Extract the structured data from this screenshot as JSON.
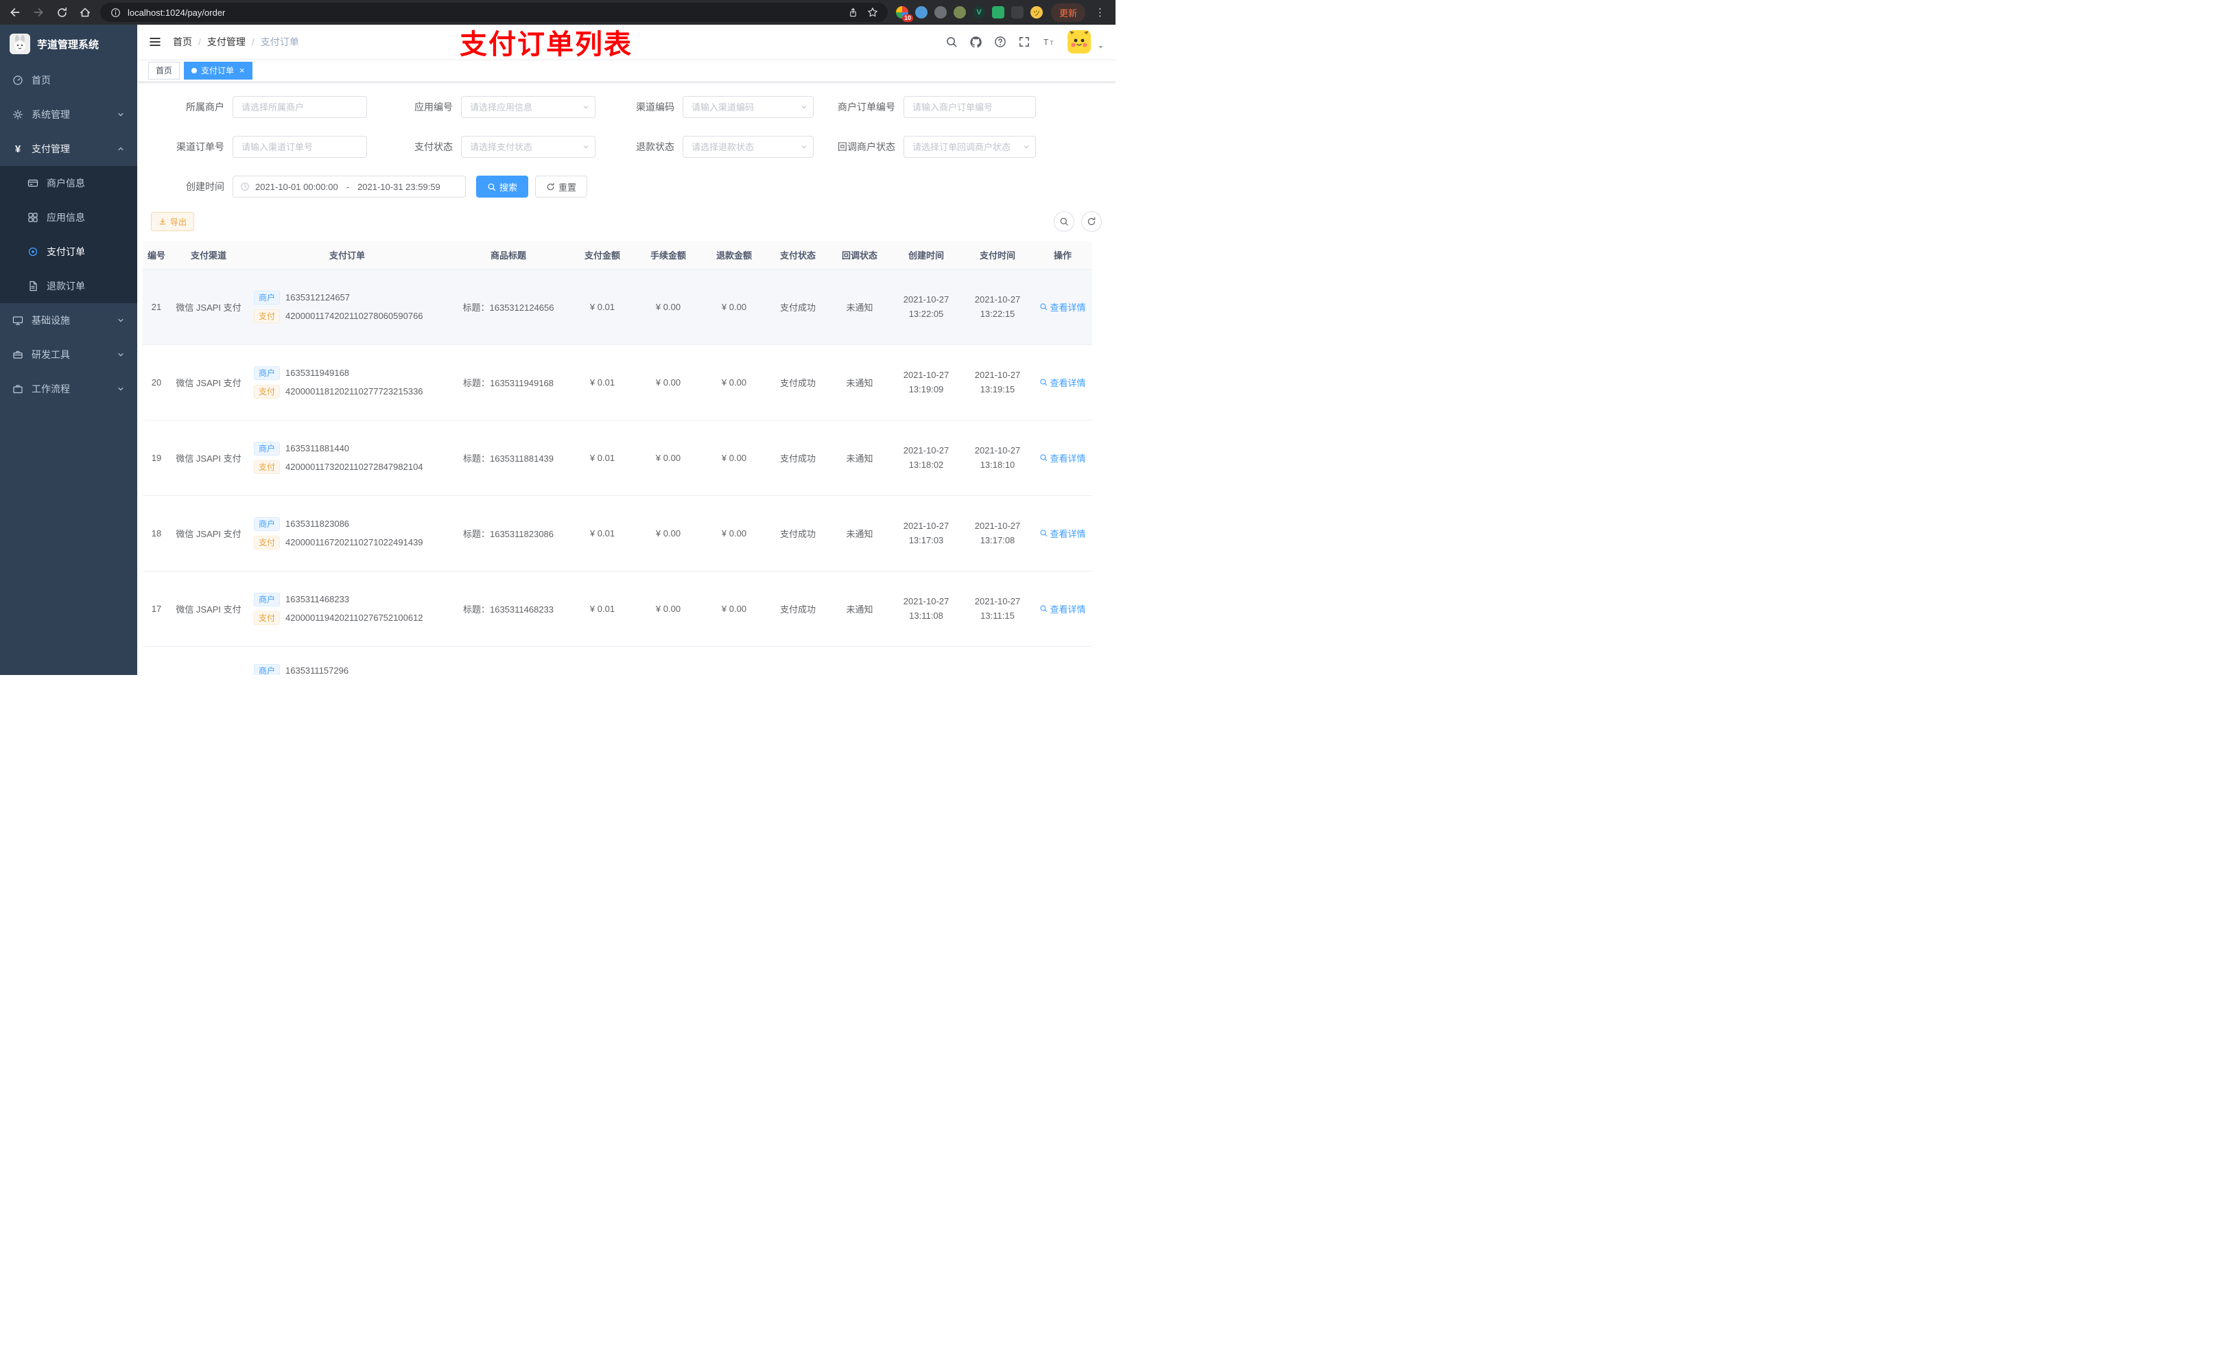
{
  "browser": {
    "url": "localhost:1024/pay/order",
    "update_label": "更新",
    "extension_badge": "10"
  },
  "sidebar": {
    "logo_title": "芋道管理系统",
    "menu": {
      "home": "首页",
      "system": "系统管理",
      "pay": "支付管理",
      "merchant_info": "商户信息",
      "app_info": "应用信息",
      "pay_order": "支付订单",
      "refund_order": "退款订单",
      "infra": "基础设施",
      "dev_tools": "研发工具",
      "workflow": "工作流程"
    }
  },
  "navbar": {
    "breadcrumb": [
      "首页",
      "支付管理",
      "支付订单"
    ],
    "annotation": "支付订单列表"
  },
  "tabs": {
    "home": "首页",
    "current": "支付订单"
  },
  "filters": {
    "merchant": {
      "label": "所属商户",
      "placeholder": "请选择所属商户"
    },
    "app": {
      "label": "应用编号",
      "placeholder": "请选择应用信息"
    },
    "channel_code": {
      "label": "渠道编码",
      "placeholder": "请输入渠道编码"
    },
    "merchant_order_no": {
      "label": "商户订单编号",
      "placeholder": "请输入商户订单编号"
    },
    "channel_order_no": {
      "label": "渠道订单号",
      "placeholder": "请输入渠道订单号"
    },
    "pay_status": {
      "label": "支付状态",
      "placeholder": "请选择支付状态"
    },
    "refund_status": {
      "label": "退款状态",
      "placeholder": "请选择退款状态"
    },
    "callback_status": {
      "label": "回调商户状态",
      "placeholder": "请选择订单回调商户状态"
    },
    "create_time": {
      "label": "创建时间",
      "start": "2021-10-01 00:00:00",
      "separator": "-",
      "end": "2021-10-31 23:59:59"
    },
    "search_label": "搜索",
    "reset_label": "重置"
  },
  "toolbar": {
    "export_label": "导出"
  },
  "table": {
    "columns": [
      "编号",
      "支付渠道",
      "支付订单",
      "商品标题",
      "支付金额",
      "手续金额",
      "退款金额",
      "支付状态",
      "回调状态",
      "创建时间",
      "支付时间",
      "操作"
    ],
    "rows": [
      {
        "id": "21",
        "channel": "微信 JSAPI 支付",
        "merchant_tag": "商户",
        "merchant_no": "1635312124657",
        "pay_tag": "支付",
        "pay_no": "4200001174202110278060590766",
        "title": "标题：1635312124656",
        "amount": "¥ 0.01",
        "fee": "¥ 0.00",
        "refund": "¥ 0.00",
        "pay_status": "支付成功",
        "notify_status": "未通知",
        "create_date": "2021-10-27",
        "create_time": "13:22:05",
        "pay_date": "2021-10-27",
        "pay_time": "13:22:15",
        "action": "查看详情"
      },
      {
        "id": "20",
        "channel": "微信 JSAPI 支付",
        "merchant_tag": "商户",
        "merchant_no": "1635311949168",
        "pay_tag": "支付",
        "pay_no": "4200001181202110277723215336",
        "title": "标题：1635311949168",
        "amount": "¥ 0.01",
        "fee": "¥ 0.00",
        "refund": "¥ 0.00",
        "pay_status": "支付成功",
        "notify_status": "未通知",
        "create_date": "2021-10-27",
        "create_time": "13:19:09",
        "pay_date": "2021-10-27",
        "pay_time": "13:19:15",
        "action": "查看详情"
      },
      {
        "id": "19",
        "channel": "微信 JSAPI 支付",
        "merchant_tag": "商户",
        "merchant_no": "1635311881440",
        "pay_tag": "支付",
        "pay_no": "4200001173202110272847982104",
        "title": "标题：1635311881439",
        "amount": "¥ 0.01",
        "fee": "¥ 0.00",
        "refund": "¥ 0.00",
        "pay_status": "支付成功",
        "notify_status": "未通知",
        "create_date": "2021-10-27",
        "create_time": "13:18:02",
        "pay_date": "2021-10-27",
        "pay_time": "13:18:10",
        "action": "查看详情"
      },
      {
        "id": "18",
        "channel": "微信 JSAPI 支付",
        "merchant_tag": "商户",
        "merchant_no": "1635311823086",
        "pay_tag": "支付",
        "pay_no": "4200001167202110271022491439",
        "title": "标题：1635311823086",
        "amount": "¥ 0.01",
        "fee": "¥ 0.00",
        "refund": "¥ 0.00",
        "pay_status": "支付成功",
        "notify_status": "未通知",
        "create_date": "2021-10-27",
        "create_time": "13:17:03",
        "pay_date": "2021-10-27",
        "pay_time": "13:17:08",
        "action": "查看详情"
      },
      {
        "id": "17",
        "channel": "微信 JSAPI 支付",
        "merchant_tag": "商户",
        "merchant_no": "1635311468233",
        "pay_tag": "支付",
        "pay_no": "4200001194202110276752100612",
        "title": "标题：1635311468233",
        "amount": "¥ 0.01",
        "fee": "¥ 0.00",
        "refund": "¥ 0.00",
        "pay_status": "支付成功",
        "notify_status": "未通知",
        "create_date": "2021-10-27",
        "create_time": "13:11:08",
        "pay_date": "2021-10-27",
        "pay_time": "13:11:15",
        "action": "查看详情"
      }
    ],
    "partial_row": {
      "merchant_tag": "商户",
      "merchant_no": "1635311157296"
    }
  },
  "colors": {
    "accent": "#409eff",
    "warning": "#e6a23c",
    "annotation": "#ff0000",
    "sidebar": "#304156",
    "sidebar_sub": "#1f2d3d"
  }
}
